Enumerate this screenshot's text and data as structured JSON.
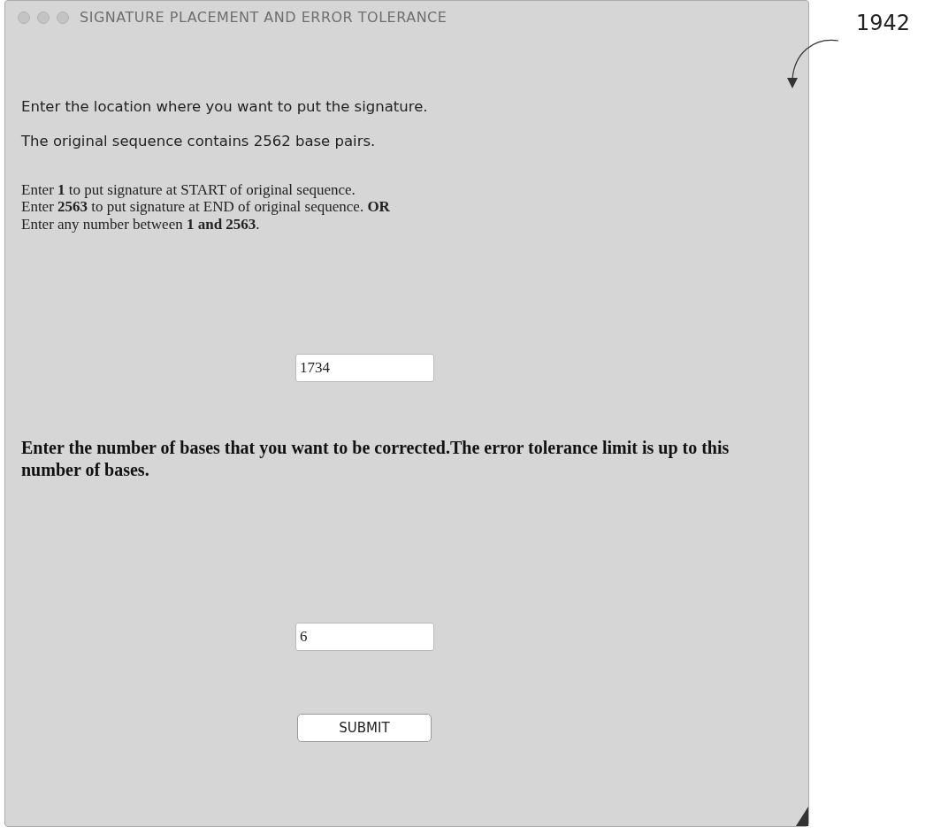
{
  "window": {
    "title": "SIGNATURE PLACEMENT AND ERROR TOLERANCE"
  },
  "reference_label": "1942",
  "intro": [
    "Enter the location where you want to put the signature.",
    "The original sequence contains 2562 base pairs."
  ],
  "instructions": [
    "Enter **1** to put signature at START of original sequence.",
    "Enter **2563** to put signature at END of original sequence. **OR**",
    "Enter any number between **1 and 2563**."
  ],
  "location_field": {
    "value": "1734"
  },
  "tolerance_prompt": "Enter the number of bases that you want to be corrected.The error tolerance limit is up to this number of bases.",
  "tolerance_field": {
    "value": "6"
  },
  "buttons": [
    "SUBMIT"
  ]
}
